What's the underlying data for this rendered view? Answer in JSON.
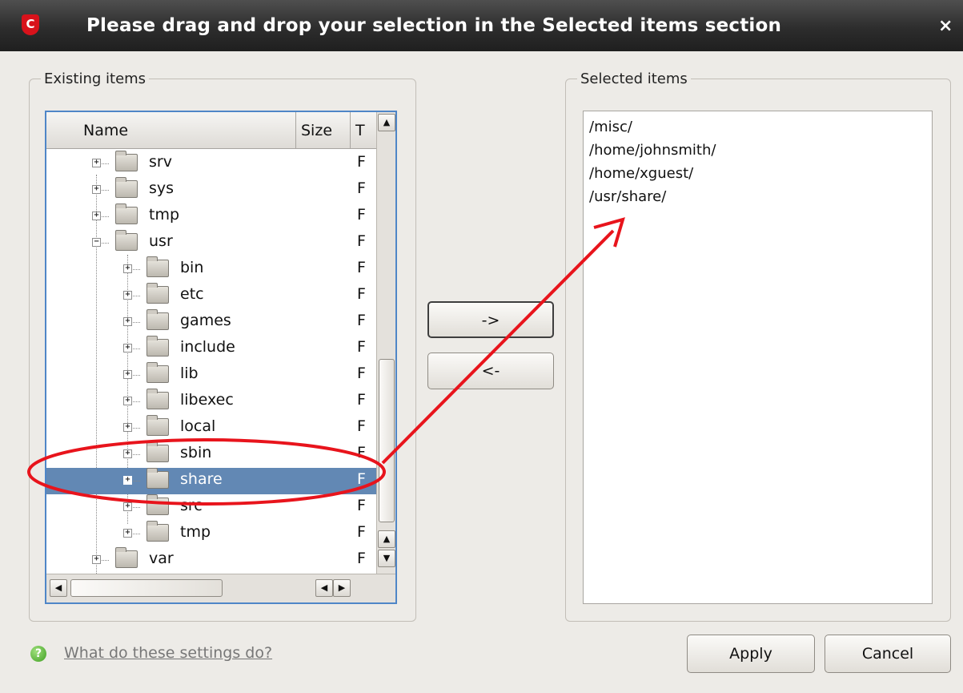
{
  "window": {
    "title": "Please drag and drop your selection in the Selected items section",
    "logo_letter": "C",
    "close_glyph": "×"
  },
  "existing": {
    "legend": "Existing items",
    "columns": {
      "name": "Name",
      "size": "Size",
      "type": "T"
    },
    "rows": [
      {
        "label": "srv",
        "type": "F"
      },
      {
        "label": "sys",
        "type": "F"
      },
      {
        "label": "tmp",
        "type": "F"
      },
      {
        "label": "usr",
        "type": "F"
      },
      {
        "label": "bin",
        "type": "F"
      },
      {
        "label": "etc",
        "type": "F"
      },
      {
        "label": "games",
        "type": "F"
      },
      {
        "label": "include",
        "type": "F"
      },
      {
        "label": "lib",
        "type": "F"
      },
      {
        "label": "libexec",
        "type": "F"
      },
      {
        "label": "local",
        "type": "F"
      },
      {
        "label": "sbin",
        "type": "F"
      },
      {
        "label": "share",
        "type": "F"
      },
      {
        "label": "src",
        "type": "F"
      },
      {
        "label": "tmp",
        "type": "F"
      },
      {
        "label": "var",
        "type": "F"
      }
    ],
    "selected_row": "share"
  },
  "buttons": {
    "add": "->",
    "remove": "<-",
    "apply": "Apply",
    "cancel": "Cancel"
  },
  "selected": {
    "legend": "Selected items",
    "items": [
      "/misc/",
      "/home/johnsmith/",
      "/home/xguest/",
      "/usr/share/"
    ]
  },
  "help": {
    "icon": "question-icon",
    "glyph": "?",
    "link": "What do these settings do?"
  },
  "colors": {
    "selection": "#6288b4",
    "annotation": "#e8141c",
    "titlebar": "#2d2d2d"
  }
}
